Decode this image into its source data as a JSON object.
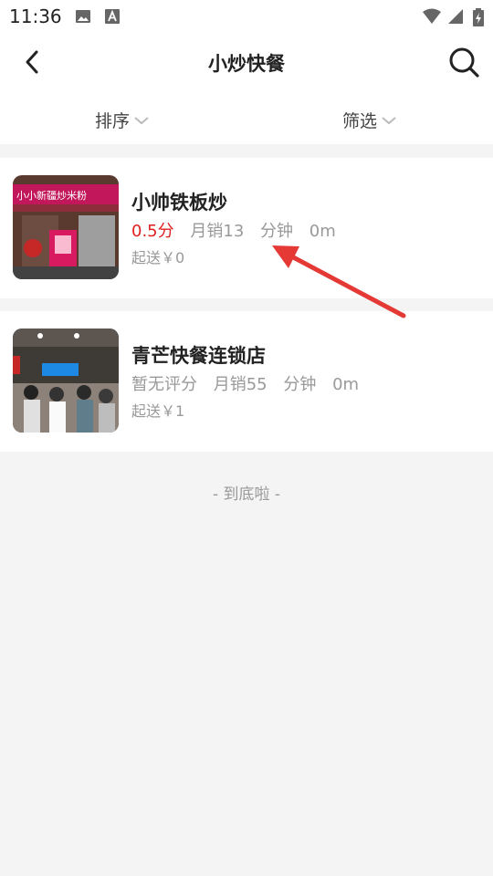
{
  "status": {
    "time": "11:36"
  },
  "nav": {
    "title": "小炒快餐"
  },
  "filters": {
    "sort_label": "排序",
    "filter_label": "筛选"
  },
  "stores": [
    {
      "name": "小帅铁板炒",
      "score": "0.5分",
      "monthly_sales": "月销13",
      "time": "分钟",
      "distance": "0m",
      "min_order": "起送￥0",
      "thumb_sign": "小小新疆炒米粉"
    },
    {
      "name": "青芒快餐连锁店",
      "score": "暂无评分",
      "monthly_sales": "月销55",
      "time": "分钟",
      "distance": "0m",
      "min_order": "起送￥1"
    }
  ],
  "footer": {
    "end_text": "- 到底啦 -"
  },
  "colors": {
    "accent_red": "#e02020",
    "annotation_arrow": "#e53935"
  }
}
